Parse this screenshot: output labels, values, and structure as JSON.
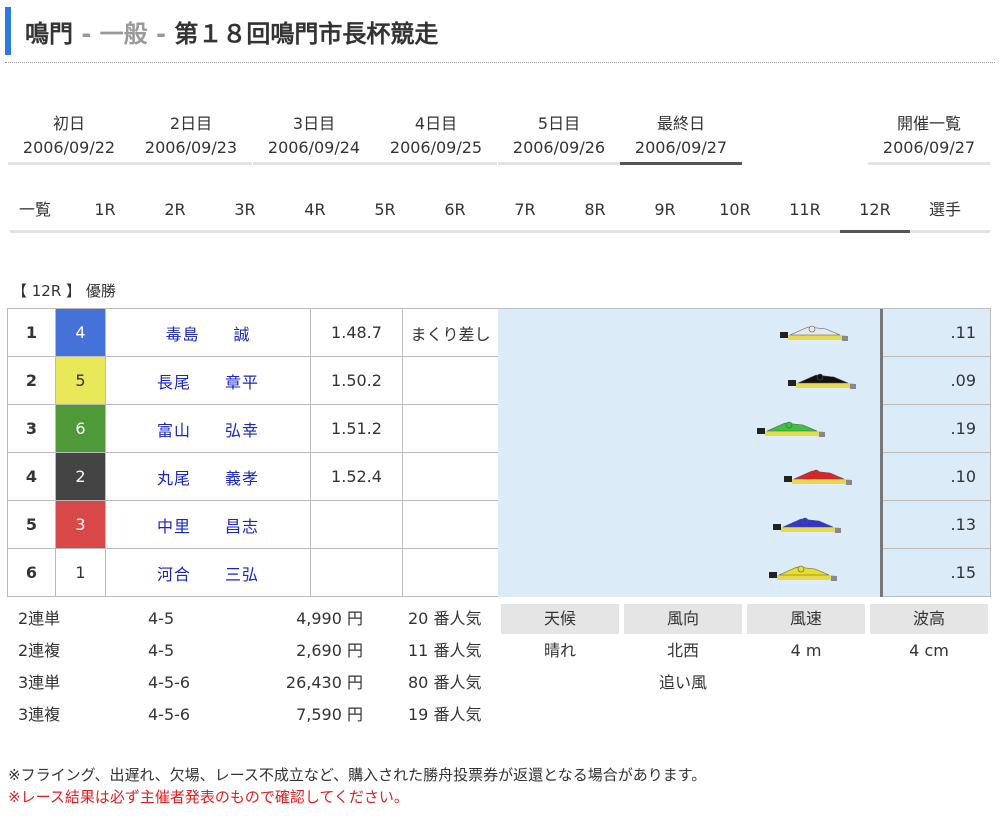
{
  "header": {
    "venue": "鳴門",
    "sep1": " - ",
    "category": "一般",
    "sep2": " - ",
    "race_title": "第１８回鳴門市長杯競走"
  },
  "days": [
    {
      "label": "初日",
      "date": "2006/09/22",
      "active": false
    },
    {
      "label": "2日目",
      "date": "2006/09/23",
      "active": false
    },
    {
      "label": "3日目",
      "date": "2006/09/24",
      "active": false
    },
    {
      "label": "4日目",
      "date": "2006/09/25",
      "active": false
    },
    {
      "label": "5日目",
      "date": "2006/09/26",
      "active": false
    },
    {
      "label": "最終日",
      "date": "2006/09/27",
      "active": true
    },
    {
      "label": "開催一覧",
      "date": "2006/09/27",
      "active": false
    }
  ],
  "races": [
    "一覧",
    "1R",
    "2R",
    "3R",
    "4R",
    "5R",
    "6R",
    "7R",
    "8R",
    "9R",
    "10R",
    "11R",
    "12R",
    "選手"
  ],
  "active_race": "12R",
  "race_label": "【 12R 】 優勝",
  "results": [
    {
      "rank": "1",
      "lane": "4",
      "last": "毒島",
      "first": "誠",
      "time": "1.48.7",
      "tech": "まくり差し",
      "st": ".11",
      "lane_color": "#4472d8",
      "lane_text": "#ffffff",
      "boat_color": "#e8e8e8",
      "boat_x": 0.73
    },
    {
      "rank": "2",
      "lane": "5",
      "last": "長尾",
      "first": "章平",
      "time": "1.50.2",
      "tech": "",
      "st": ".09",
      "lane_color": "#e8e858",
      "lane_text": "#333333",
      "boat_color": "#111111",
      "boat_x": 0.75
    },
    {
      "rank": "3",
      "lane": "6",
      "last": "富山",
      "first": "弘幸",
      "time": "1.51.2",
      "tech": "",
      "st": ".19",
      "lane_color": "#4e9a38",
      "lane_text": "#ffffff",
      "boat_color": "#3cc43c",
      "boat_x": 0.67
    },
    {
      "rank": "4",
      "lane": "2",
      "last": "丸尾",
      "first": "義孝",
      "time": "1.52.4",
      "tech": "",
      "st": ".10",
      "lane_color": "#444444",
      "lane_text": "#ffffff",
      "boat_color": "#e02424",
      "boat_x": 0.74
    },
    {
      "rank": "5",
      "lane": "3",
      "last": "中里",
      "first": "昌志",
      "time": "",
      "tech": "",
      "st": ".13",
      "lane_color": "#d94848",
      "lane_text": "#ffffff",
      "boat_color": "#3434d0",
      "boat_x": 0.71
    },
    {
      "rank": "6",
      "lane": "1",
      "last": "河合",
      "first": "三弘",
      "time": "",
      "tech": "",
      "st": ".15",
      "lane_color": "#ffffff",
      "lane_text": "#333333",
      "boat_color": "#e8e024",
      "boat_x": 0.7
    }
  ],
  "payouts": [
    {
      "type": "2連単",
      "combo": "4-5",
      "amount": "4,990 円",
      "popularity": "20 番人気"
    },
    {
      "type": "2連複",
      "combo": "4-5",
      "amount": "2,690 円",
      "popularity": "11 番人気"
    },
    {
      "type": "3連単",
      "combo": "4-5-6",
      "amount": "26,430 円",
      "popularity": "80 番人気"
    },
    {
      "type": "3連複",
      "combo": "4-5-6",
      "amount": "7,590 円",
      "popularity": "19 番人気"
    }
  ],
  "weather": {
    "headers": [
      "天候",
      "風向",
      "風速",
      "波高"
    ],
    "values": [
      "晴れ",
      "北西",
      "4 m",
      "4 cm"
    ],
    "wind_note": "追い風"
  },
  "notes": {
    "note1": "※フライング、出遅れ、欠場、レース不成立など、購入された勝舟投票券が返還となる場合があります。",
    "note2": "※レース結果は必ず主催者発表のもので確認してください。"
  }
}
